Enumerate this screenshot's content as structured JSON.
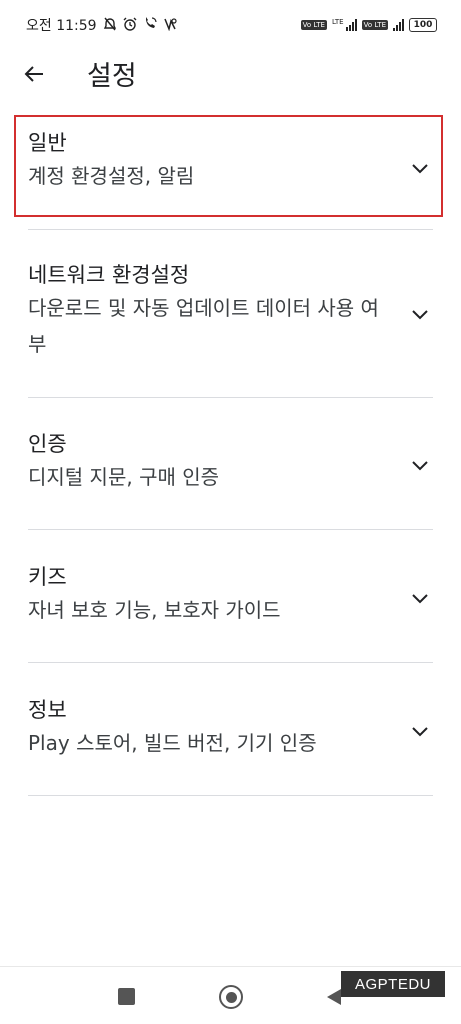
{
  "status_bar": {
    "time": "오전 11:59",
    "volte1": "Vo LTE",
    "lte": "LTE",
    "volte2": "Vo LTE",
    "battery": "100",
    "icons": [
      "mute-icon",
      "alarm-icon",
      "wifi-calling-icon",
      "data-saver-icon"
    ]
  },
  "header": {
    "title": "설정"
  },
  "settings": {
    "items": [
      {
        "title": "일반",
        "subtitle": "계정 환경설정, 알림",
        "highlighted": true
      },
      {
        "title": "네트워크 환경설정",
        "subtitle": "다운로드 및 자동 업데이트 데이터 사용 여부"
      },
      {
        "title": "인증",
        "subtitle": "디지털 지문, 구매 인증"
      },
      {
        "title": "키즈",
        "subtitle": "자녀 보호 기능, 보호자 가이드"
      },
      {
        "title": "정보",
        "subtitle": "Play 스토어, 빌드 버전, 기기 인증"
      }
    ]
  },
  "watermark": "AGPTEDU",
  "colors": {
    "highlight": "#d32f2f",
    "divider": "#dadce0",
    "text": "#202124"
  }
}
